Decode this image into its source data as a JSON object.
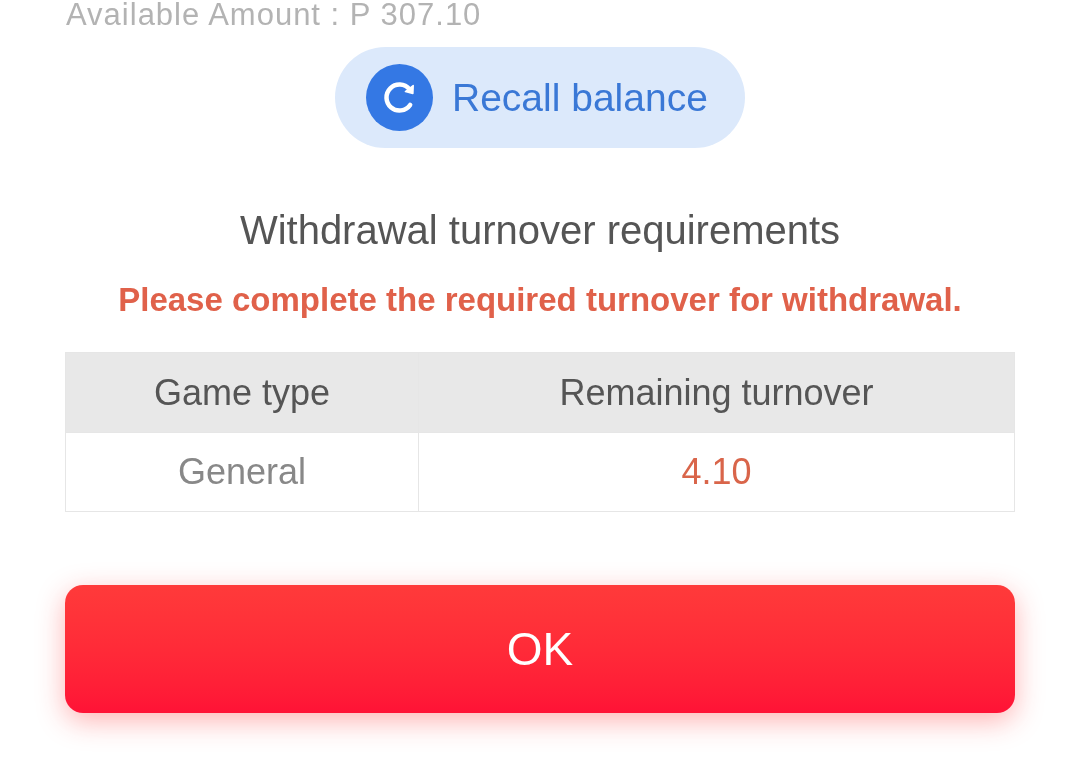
{
  "available_amount": "Available Amount : P 307.10",
  "recall_button": {
    "label": "Recall balance"
  },
  "title": "Withdrawal turnover requirements",
  "warning": "Please complete the required turnover for withdrawal.",
  "table": {
    "columns": [
      "Game type",
      "Remaining turnover"
    ],
    "rows": [
      [
        "General",
        "4.10"
      ]
    ]
  },
  "buttons": [
    {
      "label": "OK",
      "kind": "primary"
    }
  ]
}
